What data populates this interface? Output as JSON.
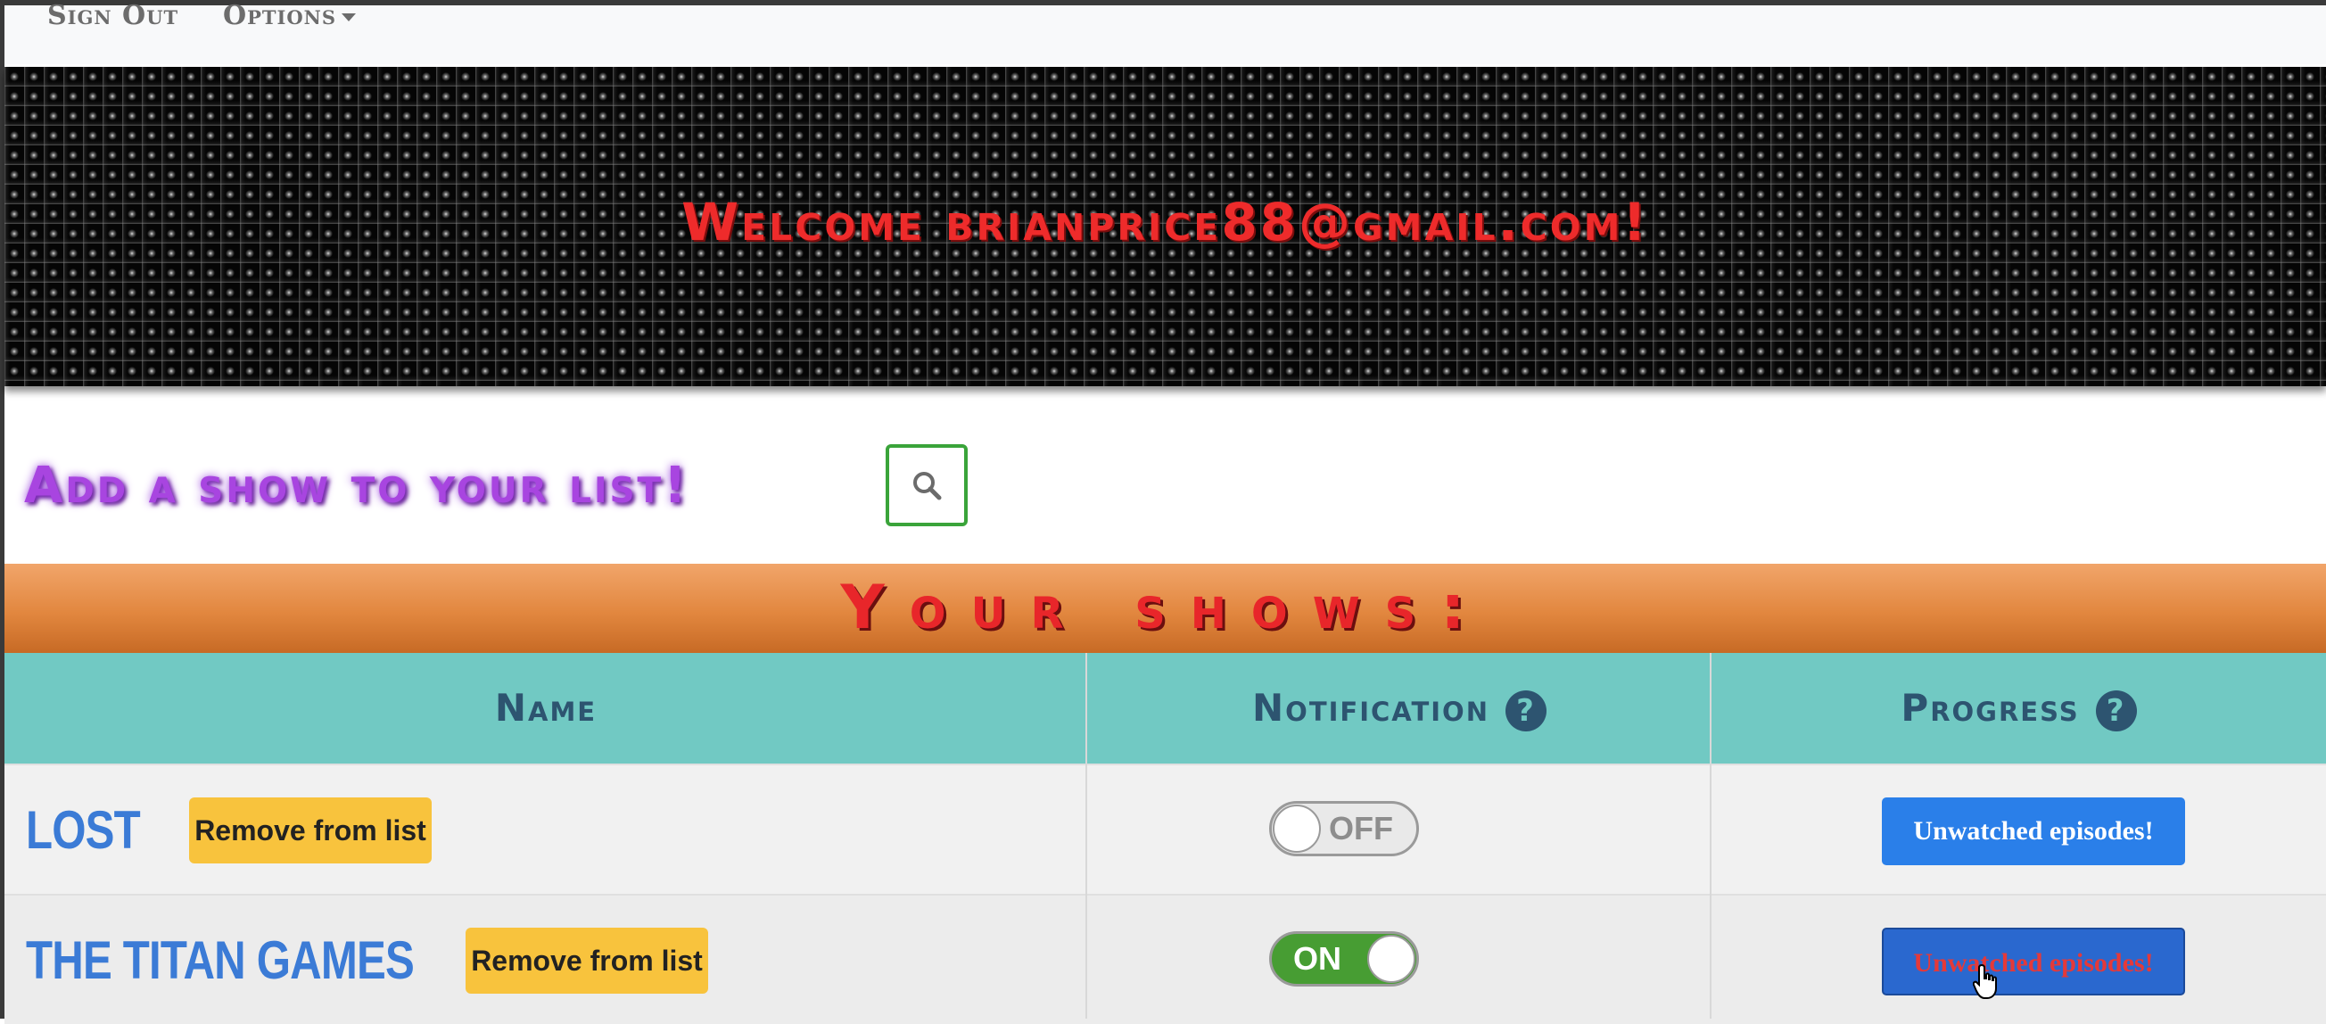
{
  "nav": {
    "sign_out": "Sign Out",
    "options": "Options"
  },
  "banner": {
    "title": "Welcome brianprice88@gmail.com!"
  },
  "add_show": {
    "label": "Add a show to your list!",
    "search_icon": "search-icon"
  },
  "shows_header": {
    "title": "Your shows:"
  },
  "table": {
    "columns": [
      {
        "label": "Name"
      },
      {
        "label": "Notification",
        "help_icon": "?"
      },
      {
        "label": "Progress",
        "help_icon": "?"
      }
    ],
    "rows": [
      {
        "name": "LOST",
        "remove_label": "Remove from list",
        "notification": "OFF",
        "notification_on": false,
        "progress_label": "Unwatched episodes!"
      },
      {
        "name": "THE TITAN GAMES",
        "remove_label": "Remove from list",
        "notification": "ON",
        "notification_on": true,
        "progress_label": "Unwatched episodes!"
      }
    ]
  },
  "colors": {
    "banner_text": "#ee2b2b",
    "add_show_text": "#a845e0",
    "header_bar": "#e2873f",
    "table_header": "#71c9c3",
    "show_name": "#3b7bd6",
    "remove_button": "#f8c33d",
    "toggle_on": "#479d33",
    "progress_button": "#2a7fe9"
  }
}
